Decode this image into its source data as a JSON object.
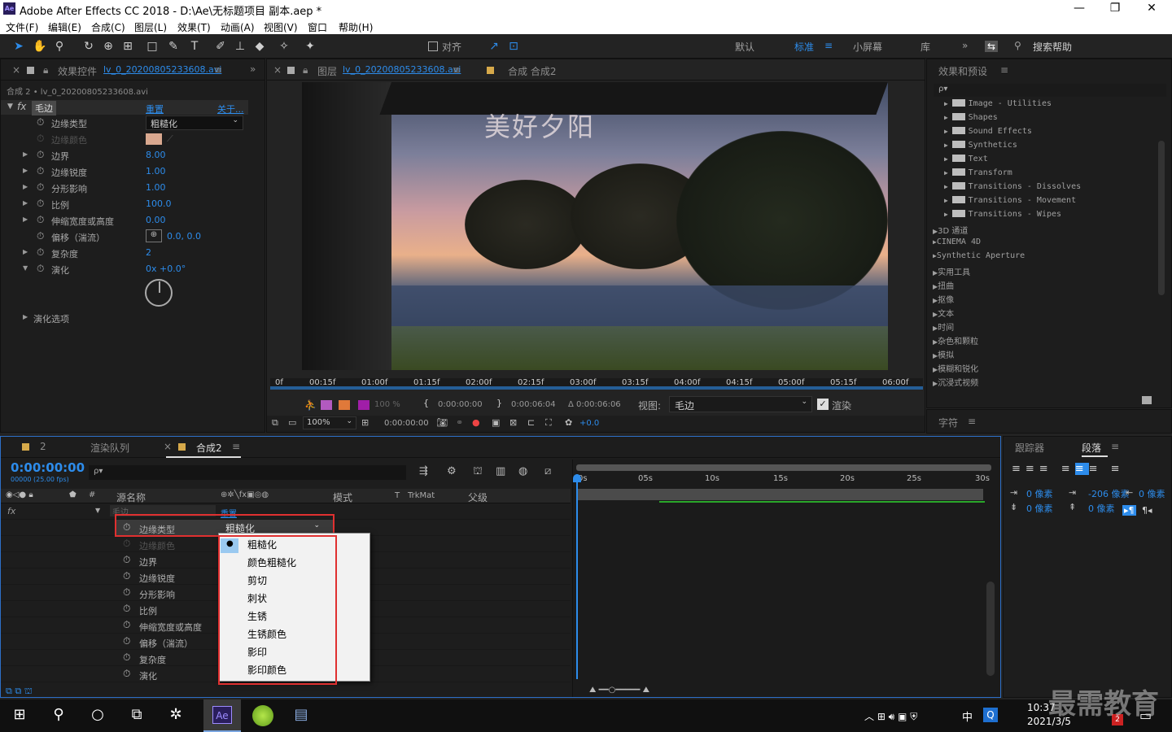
{
  "app": {
    "logo": "Ae",
    "title": "Adobe After Effects CC 2018 - D:\\Ae\\无标题项目 副本.aep *",
    "window_controls": [
      "—",
      "❐",
      "✕"
    ]
  },
  "menu": [
    "文件(F)",
    "编辑(E)",
    "合成(C)",
    "图层(L)",
    "效果(T)",
    "动画(A)",
    "视图(V)",
    "窗口",
    "帮助(H)"
  ],
  "toolbar": {
    "snap_label": "对齐",
    "workspaces": [
      "默认",
      "标准",
      "小屏幕",
      "库"
    ],
    "active_workspace": "标准",
    "search_help": "搜索帮助"
  },
  "effect_controls": {
    "tab_prefix": "效果控件",
    "tab_layer": "lv_0_20200805233608.avi",
    "breadcrumb": "合成 2 • lv_0_20200805233608.avi",
    "effect_name": "毛边",
    "reset": "重置",
    "about": "关于...",
    "properties": [
      {
        "label": "边缘类型",
        "value": "粗糙化",
        "type": "dropdown"
      },
      {
        "label": "边缘颜色",
        "value": "",
        "type": "color",
        "color": "#d9a88f"
      },
      {
        "label": "边界",
        "value": "8.00"
      },
      {
        "label": "边缘锐度",
        "value": "1.00"
      },
      {
        "label": "分形影响",
        "value": "1.00"
      },
      {
        "label": "比例",
        "value": "100.0"
      },
      {
        "label": "伸缩宽度或高度",
        "value": "0.00"
      },
      {
        "label": "偏移（湍流）",
        "value": "0.0, 0.0"
      },
      {
        "label": "复杂度",
        "value": "2"
      },
      {
        "label": "演化",
        "value": "0x +0.0°"
      }
    ],
    "evolution_options": "演化选项"
  },
  "viewer": {
    "tab_prefix": "图层",
    "tab_layer": "lv_0_20200805233608.avi",
    "comp_tab": "合成 合成2",
    "overlay_text": "美好夕阳",
    "ruler": [
      "0f",
      "00:15f",
      "01:00f",
      "01:15f",
      "02:00f",
      "02:15f",
      "03:00f",
      "03:15f",
      "04:00f",
      "04:15f",
      "05:00f",
      "05:15f",
      "06:00f"
    ],
    "in_time": "0:00:00:00",
    "out_time": "0:00:06:04",
    "duration": "Δ 0:00:06:06",
    "view_label": "视图:",
    "view_value": "毛边",
    "render_label": "渲染",
    "zoom": "100%",
    "timecode": "0:00:00:00",
    "exposure": "+0.0",
    "opacity": "100 %"
  },
  "effects_presets": {
    "title": "效果和预设",
    "search_placeholder": "ρ▾",
    "items": [
      "Image - Utilities",
      "Shapes",
      "Sound Effects",
      "Synthetics",
      "Text",
      "Transform",
      "Transitions - Dissolves",
      "Transitions - Movement",
      "Transitions - Wipes"
    ],
    "categories": [
      "3D 通道",
      "CINEMA 4D",
      "Synthetic Aperture",
      "实用工具",
      "扭曲",
      "抠像",
      "文本",
      "时间",
      "杂色和颗粒",
      "模拟",
      "模糊和锐化",
      "沉浸式视频"
    ],
    "character_tab": "字符"
  },
  "paragraph": {
    "tracker_tab": "跟踪器",
    "paragraph_tab": "段落",
    "indent_left": "0 像素",
    "indent_first": "-206 像素",
    "indent_right": "0 像素",
    "space_before": "0 像素",
    "space_after": "0 像素"
  },
  "timeline": {
    "tab_number": "2",
    "render_queue": "渲染队列",
    "comp_tab": "合成2",
    "timecode": "0:00:00:00",
    "fps": "00000 (25.00 fps)",
    "search_placeholder": "ρ▾",
    "col_source": "源名称",
    "col_mode": "模式",
    "col_t": "T",
    "col_trkmat": "TrkMat",
    "col_parent": "父级",
    "effect_row": "毛边",
    "reset": "重置",
    "fx_label": "fx",
    "properties": [
      "边缘类型",
      "边缘颜色",
      "边界",
      "边缘锐度",
      "分形影响",
      "比例",
      "伸缩宽度或高度",
      "偏移（湍流）",
      "复杂度",
      "演化"
    ],
    "edge_type_value": "粗糙化",
    "ruler": [
      "0s",
      "05s",
      "10s",
      "15s",
      "20s",
      "25s",
      "30s"
    ]
  },
  "dropdown": {
    "options": [
      "粗糙化",
      "颜色粗糙化",
      "剪切",
      "刺状",
      "生锈",
      "生锈颜色",
      "影印",
      "影印颜色"
    ],
    "selected": "粗糙化"
  },
  "taskbar": {
    "app_label": "Ae",
    "ime": "中",
    "time": "10:37",
    "date": "2021/3/5",
    "notify_count": "2",
    "watermark": "最需教育"
  }
}
